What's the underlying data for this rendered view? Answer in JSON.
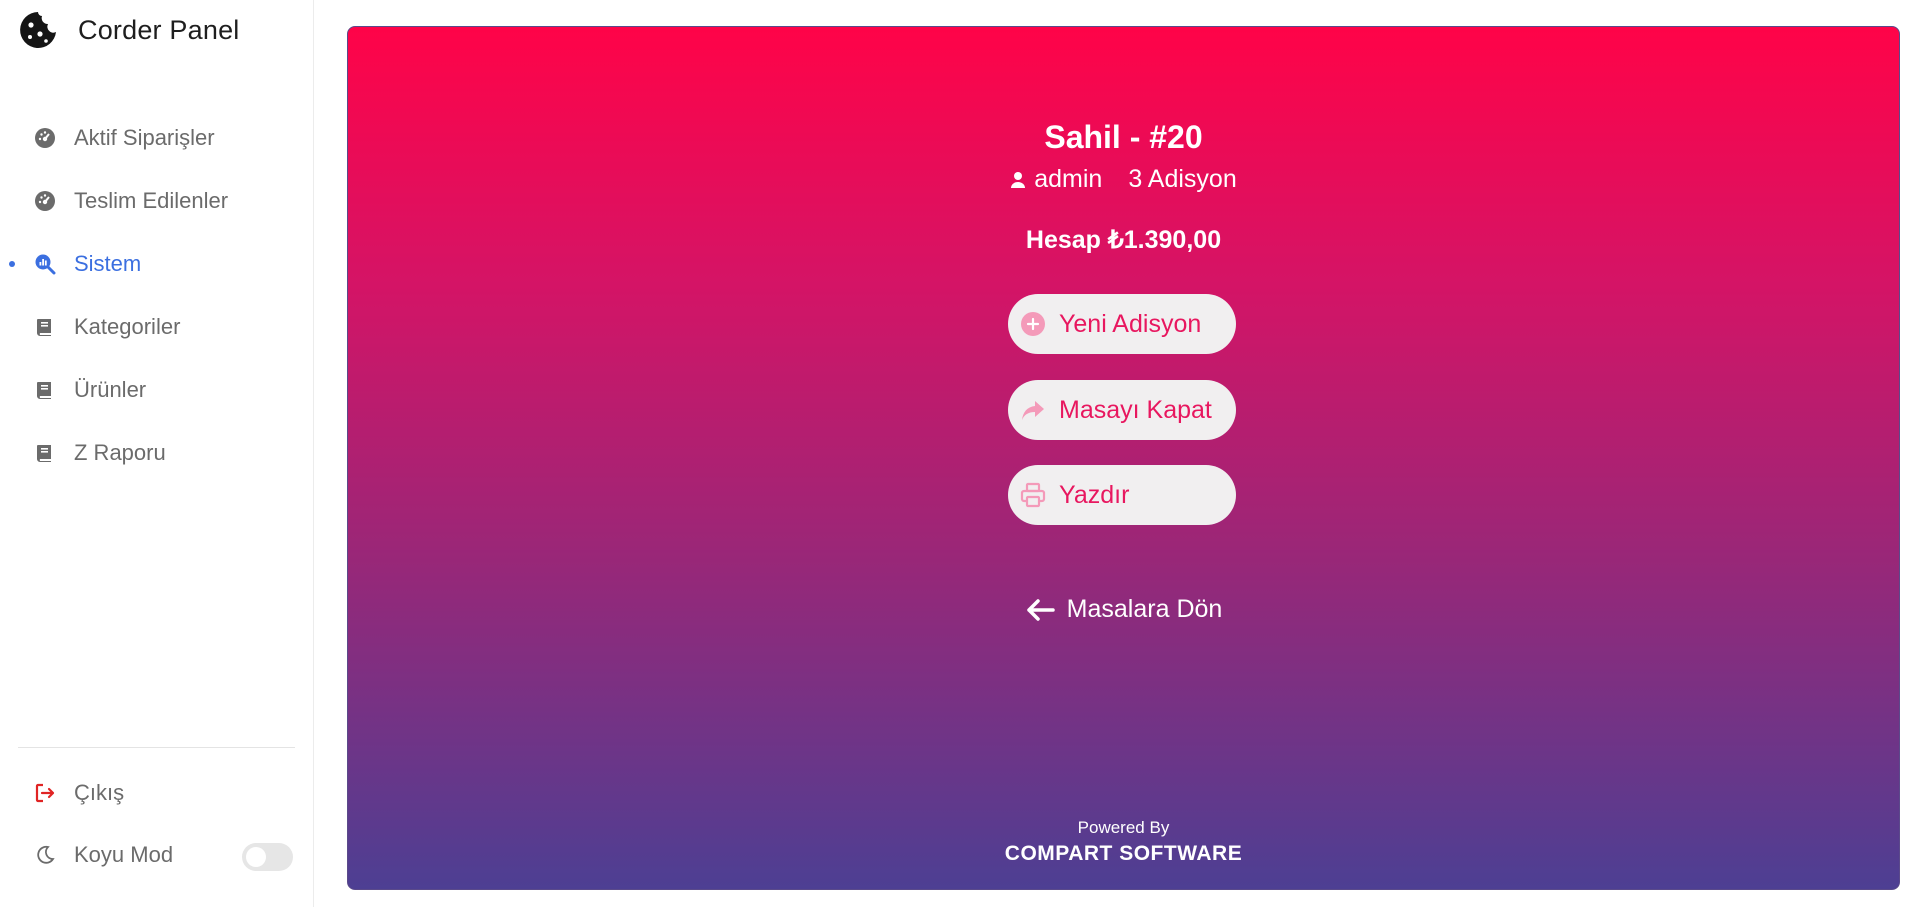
{
  "app": {
    "title": "Corder Panel",
    "logo_icon": "cookie-icon"
  },
  "sidebar": {
    "items": [
      {
        "label": "Aktif Siparişler",
        "icon": "dashboard-icon",
        "active": false
      },
      {
        "label": "Teslim Edilenler",
        "icon": "dashboard-icon",
        "active": false
      },
      {
        "label": "Sistem",
        "icon": "search-chart-icon",
        "active": true
      },
      {
        "label": "Kategoriler",
        "icon": "book-icon",
        "active": false
      },
      {
        "label": "Ürünler",
        "icon": "book-icon",
        "active": false
      },
      {
        "label": "Z Raporu",
        "icon": "book-icon",
        "active": false
      }
    ],
    "logout_label": "Çıkış",
    "dark_mode_label": "Koyu Mod",
    "dark_mode_on": false
  },
  "colors": {
    "accent": "#3b6fe0",
    "logout_icon": "#e02424",
    "gradient_top": "#ff0348",
    "gradient_bottom": "#4d3f93",
    "button_text": "#e8175f",
    "button_icon": "#f49ab9"
  },
  "table": {
    "title": "Sahil - #20",
    "user": "admin",
    "receipts": "3 Adisyon",
    "bill": "Hesap ₺1.390,00"
  },
  "actions": {
    "new_receipt": "Yeni Adisyon",
    "close_table": "Masayı Kapat",
    "print": "Yazdır",
    "back": "Masalara Dön"
  },
  "footer": {
    "powered_by": "Powered By",
    "company": "COMPART SOFTWARE"
  }
}
